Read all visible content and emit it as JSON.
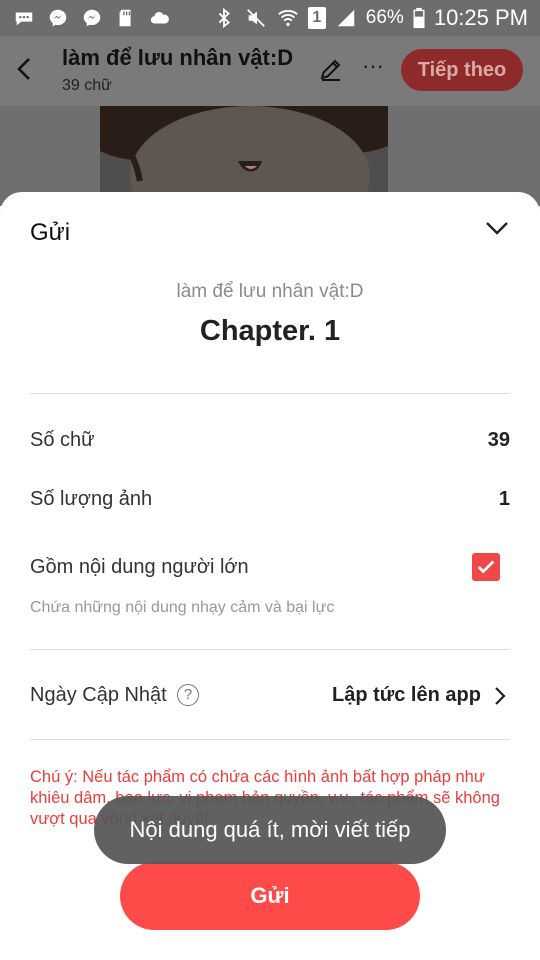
{
  "status_bar": {
    "battery_percent": "66%",
    "time": "10:25 PM",
    "sim_label": "1",
    "icons": [
      "message-icon",
      "messenger-icon",
      "messenger-icon",
      "sd-card-icon",
      "cloud-icon",
      "bluetooth-icon",
      "mute-icon",
      "wifi-icon",
      "signal-icon",
      "battery-icon"
    ]
  },
  "header": {
    "title": "làm để lưu nhân vật:D",
    "word_count": "39 chữ",
    "next_label": "Tiếp theo",
    "more_label": "···"
  },
  "sheet": {
    "title": "Gửi",
    "story_name": "làm để lưu nhân vật:D",
    "chapter_title": "Chapter. 1",
    "word_count_label": "Số chữ",
    "word_count_value": "39",
    "image_count_label": "Số lượng ảnh",
    "image_count_value": "1",
    "adult_label": "Gồm nội dung người lớn",
    "adult_checked": true,
    "adult_desc": "Chứa những nội dung nhạy cảm và bại lực",
    "update_label": "Ngày Cập Nhật",
    "update_help": "?",
    "update_value": "Lập tức lên app",
    "warning": "Chú ý: Nếu tác phẩm có chứa các hình ảnh bất hợp pháp như khiêu dâm, bạo lực, vi phạm bản quyền, v.v., tác phẩm sẽ không vượt qua vòng xét duyệt.",
    "submit_label": "Gửi"
  },
  "toast": {
    "message": "Nội dung quá ít, mời viết tiếp"
  },
  "colors": {
    "accent": "#ff4a4a",
    "warning": "#ef3b3b",
    "checkbox": "#f04848"
  }
}
